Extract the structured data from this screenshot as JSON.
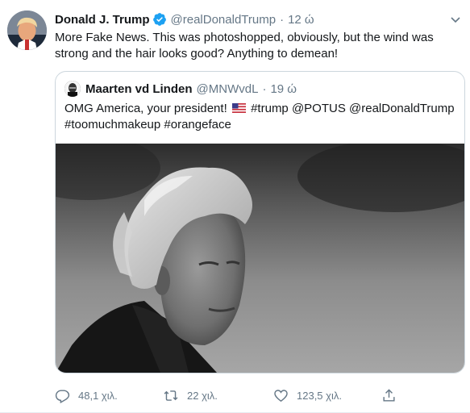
{
  "tweet": {
    "author_name": "Donald J. Trump",
    "handle": "@realDonaldTrump",
    "separator": "·",
    "time": "12 ώ",
    "text": "More Fake News. This was photoshopped, obviously, but the wind was strong and the hair looks good? Anything to demean!"
  },
  "quote": {
    "author_name": "Maarten vd Linden",
    "handle": "@MNWvdL",
    "separator": "·",
    "time": "19 ώ",
    "text_before_flag": "OMG America, your president!",
    "text_after_flag": "#trump @POTUS @realDonaldTrump #toomuchmakeup #orangeface",
    "flag_icon": "us-flag-icon"
  },
  "actions": {
    "replies": "48,1 χιλ.",
    "retweets": "22 χιλ.",
    "likes": "123,5 χιλ."
  },
  "colors": {
    "accent": "#1da1f2",
    "muted": "#657786",
    "border": "#ccd6dd"
  }
}
